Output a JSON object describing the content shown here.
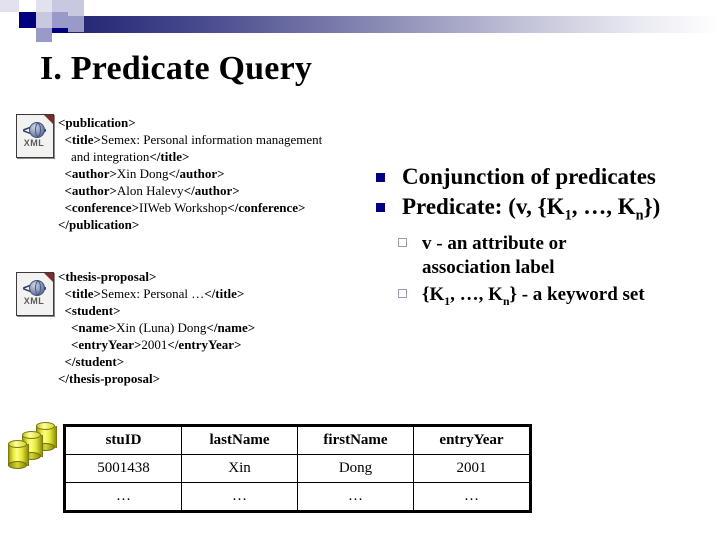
{
  "slide": {
    "title": "I. Predicate Query"
  },
  "banner": {
    "icon_name": "decorative-checker-banner"
  },
  "xml_blocks": [
    {
      "icon_label": "XML",
      "lines": [
        [
          {
            "t": "tag",
            "s": "<publication>"
          }
        ],
        [
          {
            "t": "tag",
            "s": "  <title>"
          },
          {
            "t": "val",
            "s": "Semex: Personal information management"
          }
        ],
        [
          {
            "t": "val",
            "s": "    and integration"
          },
          {
            "t": "tag",
            "s": "</title>"
          }
        ],
        [
          {
            "t": "tag",
            "s": "  <author>"
          },
          {
            "t": "val",
            "s": "Xin Dong"
          },
          {
            "t": "tag",
            "s": "</author>"
          }
        ],
        [
          {
            "t": "tag",
            "s": "  <author>"
          },
          {
            "t": "val",
            "s": "Alon Halevy"
          },
          {
            "t": "tag",
            "s": "</author>"
          }
        ],
        [
          {
            "t": "tag",
            "s": "  <conference>"
          },
          {
            "t": "val",
            "s": "IIWeb Workshop"
          },
          {
            "t": "tag",
            "s": "</conference>"
          }
        ],
        [
          {
            "t": "tag",
            "s": "</publication>"
          }
        ]
      ]
    },
    {
      "icon_label": "XML",
      "lines": [
        [
          {
            "t": "tag",
            "s": "<thesis-proposal>"
          }
        ],
        [
          {
            "t": "tag",
            "s": "  <title>"
          },
          {
            "t": "val",
            "s": "Semex: Personal …"
          },
          {
            "t": "tag",
            "s": "</title>"
          }
        ],
        [
          {
            "t": "tag",
            "s": "  <student>"
          }
        ],
        [
          {
            "t": "tag",
            "s": "    <name>"
          },
          {
            "t": "val",
            "s": "Xin (Luna) Dong"
          },
          {
            "t": "tag",
            "s": "</name>"
          }
        ],
        [
          {
            "t": "tag",
            "s": "    <entryYear>"
          },
          {
            "t": "val",
            "s": "2001"
          },
          {
            "t": "tag",
            "s": "</entryYear>"
          }
        ],
        [
          {
            "t": "tag",
            "s": "  </student>"
          }
        ],
        [
          {
            "t": "tag",
            "s": "</thesis-proposal>"
          }
        ]
      ]
    }
  ],
  "bullets": {
    "b1": "Conjunction of predicates",
    "b2_prefix": "Predicate: (v, {K",
    "b2_sub1": "1",
    "b2_mid": ", …, K",
    "b2_sub2": "n",
    "b2_suffix": "})",
    "s1_line1": "v - an attribute or",
    "s1_line2": "association label",
    "s2_prefix": "{K",
    "s2_sub1": "1",
    "s2_mid": ", …, K",
    "s2_sub2": "n",
    "s2_suffix": "} - a keyword set"
  },
  "table": {
    "headers": [
      "stuID",
      "lastName",
      "firstName",
      "entryYear"
    ],
    "rows": [
      [
        "5001438",
        "Xin",
        "Dong",
        "2001"
      ],
      [
        "…",
        "…",
        "…",
        "…"
      ]
    ]
  },
  "colors": {
    "bullet_square": "#000080",
    "hollow_square_border": "#9a9ab0",
    "banner_dark": "#20216e"
  }
}
